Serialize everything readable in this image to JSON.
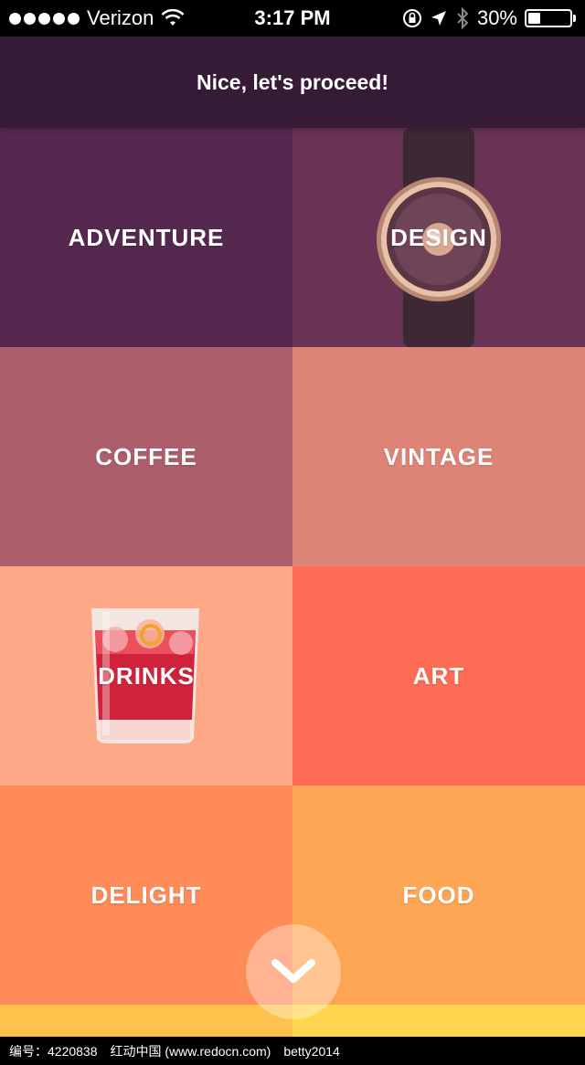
{
  "status_bar": {
    "carrier": "Verizon",
    "time": "3:17 PM",
    "battery_text": "30%",
    "battery_level": 0.3
  },
  "header": {
    "title": "Nice, let's proceed!"
  },
  "tiles": [
    {
      "label": "ADVENTURE",
      "color": "#55294f"
    },
    {
      "label": "DESIGN",
      "color": "#6a3254"
    },
    {
      "label": "COFFEE",
      "color": "#ad5e6b"
    },
    {
      "label": "VINTAGE",
      "color": "#de8476"
    },
    {
      "label": "DRINKS",
      "color": "#ffa887"
    },
    {
      "label": "ART",
      "color": "#ff6c55"
    },
    {
      "label": "DELIGHT",
      "color": "#ff8b58"
    },
    {
      "label": "FOOD",
      "color": "#ffa655"
    }
  ],
  "next_row_colors": [
    "#ffc24c",
    "#ffd64d"
  ],
  "fab": {
    "icon": "chevron-down-icon"
  },
  "footer": {
    "id_text": "编号：4220838",
    "site_text": "红动中国 (www.redocn.com)",
    "author_text": "betty2014"
  }
}
